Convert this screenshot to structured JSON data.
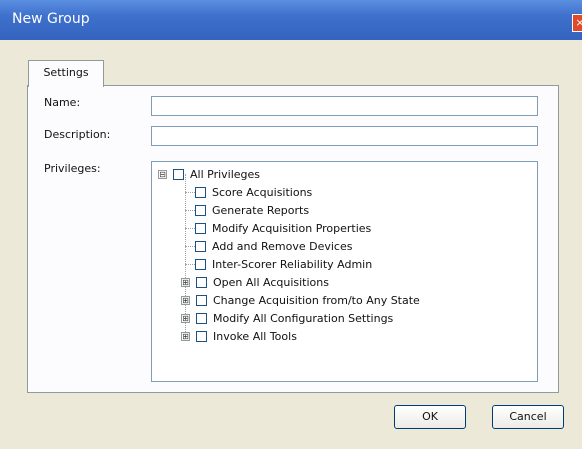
{
  "window": {
    "title": "New Group"
  },
  "tabs": [
    {
      "label": "Settings"
    }
  ],
  "form": {
    "name_label": "Name:",
    "name_value": "",
    "description_label": "Description:",
    "description_value": "",
    "privileges_label": "Privileges:"
  },
  "tree": {
    "root": {
      "label": "All Privileges",
      "expander": "⊟"
    },
    "items": [
      {
        "label": "Score Acquisitions"
      },
      {
        "label": "Generate Reports"
      },
      {
        "label": "Modify Acquisition Properties"
      },
      {
        "label": "Add and Remove Devices"
      },
      {
        "label": "Inter-Scorer Reliability Admin"
      },
      {
        "label": "Open All Acquisitions",
        "expander": "⊞"
      },
      {
        "label": "Change Acquisition from/to Any State",
        "expander": "⊞"
      },
      {
        "label": "Modify All Configuration Settings",
        "expander": "⊞"
      },
      {
        "label": "Invoke All Tools",
        "expander": "⊞"
      }
    ]
  },
  "buttons": {
    "ok": "OK",
    "cancel": "Cancel"
  },
  "icons": {
    "close": "close-icon"
  },
  "colors": {
    "titlebar": "#3e70cc",
    "dialog_bg": "#ece9d8",
    "border": "#7f9db9"
  }
}
